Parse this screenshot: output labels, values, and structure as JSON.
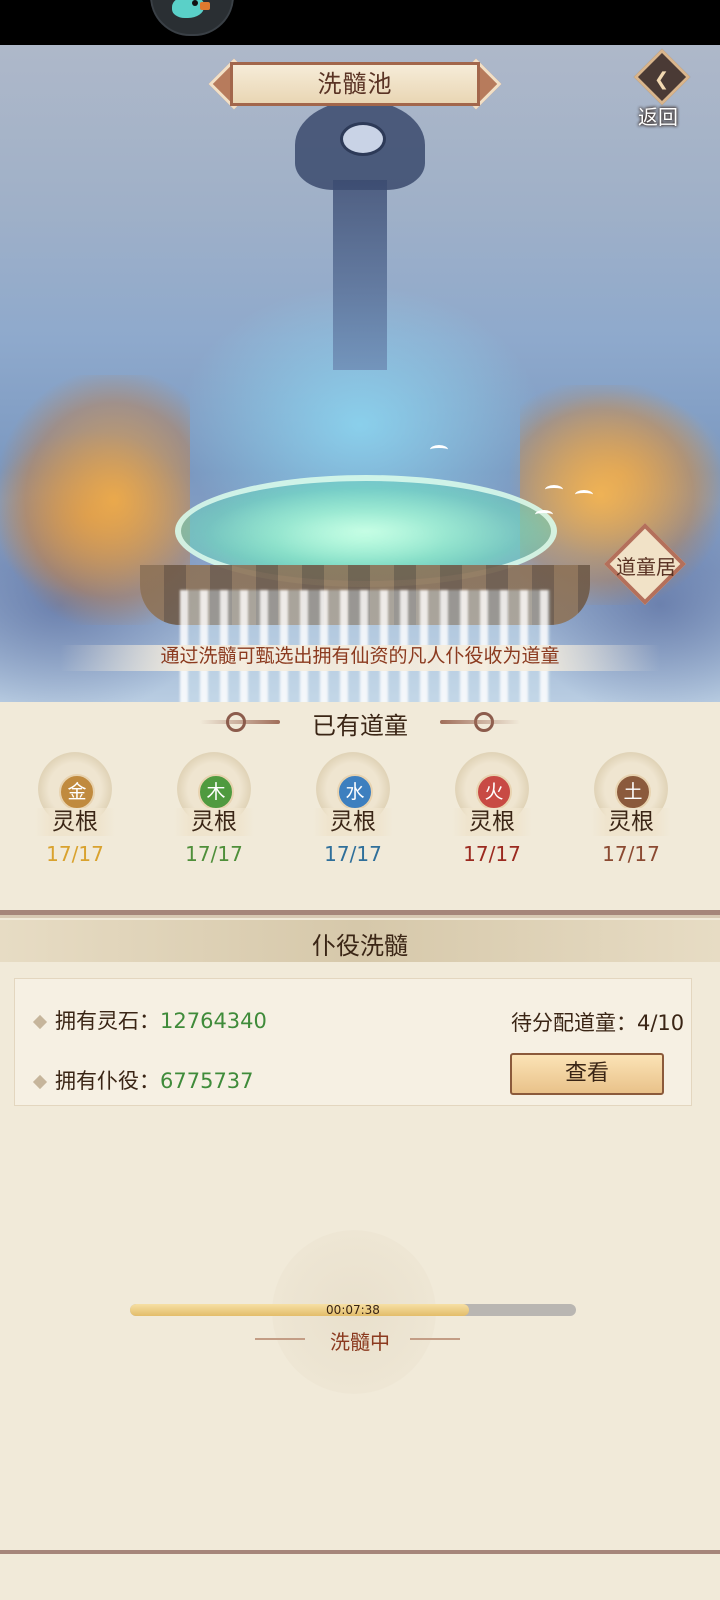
{
  "header": {
    "title": "洗髓池",
    "back_label": "返回"
  },
  "scene": {
    "daotongju_label": "道童居",
    "description": "通过洗髓可甄选出拥有仙资的凡人仆役收为道童"
  },
  "daotong_section": {
    "title": "已有道童",
    "roots": [
      {
        "element": "金",
        "label": "灵根",
        "count": "17/17",
        "badge_color": "#c08a3e",
        "count_color": "#d9a22e"
      },
      {
        "element": "木",
        "label": "灵根",
        "count": "17/17",
        "badge_color": "#4f9a3f",
        "count_color": "#4f8f3a"
      },
      {
        "element": "水",
        "label": "灵根",
        "count": "17/17",
        "badge_color": "#3d7fbf",
        "count_color": "#2f6f9a"
      },
      {
        "element": "火",
        "label": "灵根",
        "count": "17/17",
        "badge_color": "#c84a44",
        "count_color": "#9b2a20"
      },
      {
        "element": "土",
        "label": "灵根",
        "count": "17/17",
        "badge_color": "#8b5a3c",
        "count_color": "#8b4a32"
      }
    ]
  },
  "servant_section": {
    "title": "仆役洗髓",
    "stones_label": "拥有灵石：",
    "stones_value": "12764340",
    "servants_label": "拥有仆役：",
    "servants_value": "6775737",
    "pending_label": "待分配道童：",
    "pending_value": "4/10",
    "view_button": "查看"
  },
  "progress": {
    "time": "00:07:38",
    "status": "洗髓中",
    "fraction": 0.76
  }
}
